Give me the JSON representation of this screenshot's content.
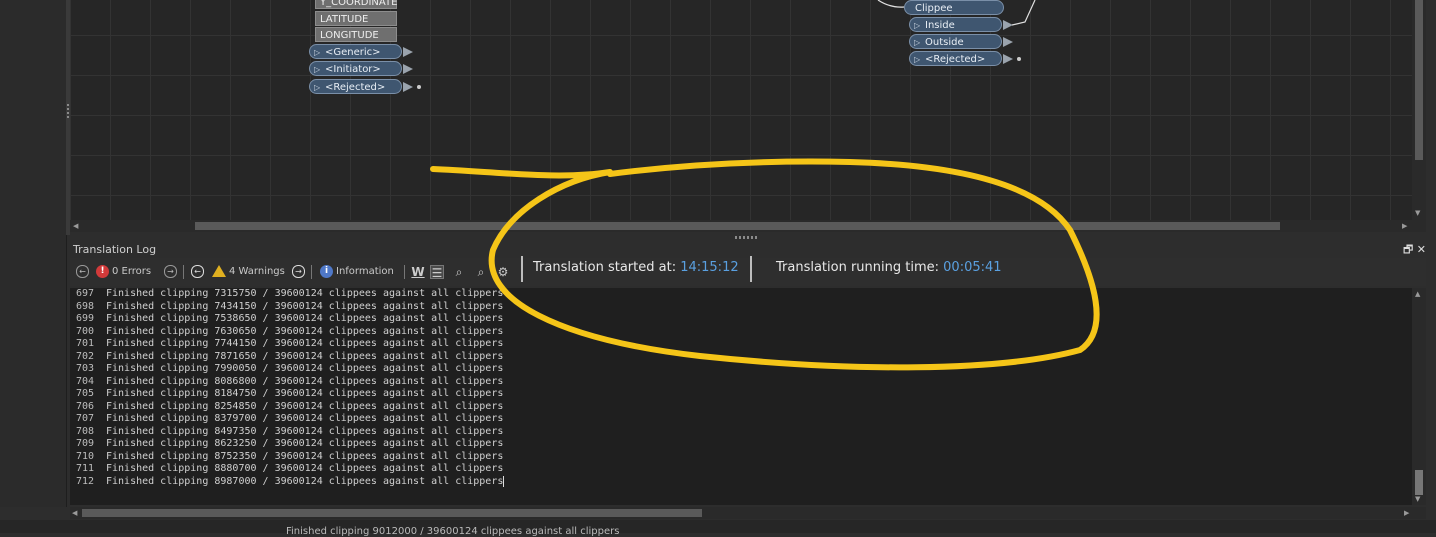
{
  "canvas": {
    "attributes": [
      "Y_COORDINATE",
      "LATITUDE",
      "LONGITUDE"
    ],
    "left_ports": [
      "<Generic>",
      "<Initiator>",
      "<Rejected>"
    ],
    "right_ports": [
      "Clippee",
      "Inside",
      "Outside",
      "<Rejected>"
    ]
  },
  "log_panel": {
    "title": "Translation Log",
    "errors_label": "0 Errors",
    "warnings_label": "4 Warnings",
    "information_label": "Information",
    "started_label": "Translation started at:",
    "started_value": "14:15:12",
    "running_label": "Translation running time:",
    "running_value": "00:05:41"
  },
  "log_lines": [
    {
      "n": "697",
      "text": "Finished clipping 7315750 / 39600124 clippees against all clippers"
    },
    {
      "n": "698",
      "text": "Finished clipping 7434150 / 39600124 clippees against all clippers"
    },
    {
      "n": "699",
      "text": "Finished clipping 7538650 / 39600124 clippees against all clippers"
    },
    {
      "n": "700",
      "text": "Finished clipping 7630650 / 39600124 clippees against all clippers"
    },
    {
      "n": "701",
      "text": "Finished clipping 7744150 / 39600124 clippees against all clippers"
    },
    {
      "n": "702",
      "text": "Finished clipping 7871650 / 39600124 clippees against all clippers"
    },
    {
      "n": "703",
      "text": "Finished clipping 7990050 / 39600124 clippees against all clippers"
    },
    {
      "n": "704",
      "text": "Finished clipping 8086800 / 39600124 clippees against all clippers"
    },
    {
      "n": "705",
      "text": "Finished clipping 8184750 / 39600124 clippees against all clippers"
    },
    {
      "n": "706",
      "text": "Finished clipping 8254850 / 39600124 clippees against all clippers"
    },
    {
      "n": "707",
      "text": "Finished clipping 8379700 / 39600124 clippees against all clippers"
    },
    {
      "n": "708",
      "text": "Finished clipping 8497350 / 39600124 clippees against all clippers"
    },
    {
      "n": "709",
      "text": "Finished clipping 8623250 / 39600124 clippees against all clippers"
    },
    {
      "n": "710",
      "text": "Finished clipping 8752350 / 39600124 clippees against all clippers"
    },
    {
      "n": "711",
      "text": "Finished clipping 8880700 / 39600124 clippees against all clippers"
    },
    {
      "n": "712",
      "text": "Finished clipping 8987000 / 39600124 clippees against all clippers"
    }
  ],
  "status_bar": {
    "text": "Finished clipping 9012000 / 39600124 clippees against all clippers"
  },
  "colors": {
    "annotation": "#f5c518",
    "time_value": "#5aa0e0"
  }
}
